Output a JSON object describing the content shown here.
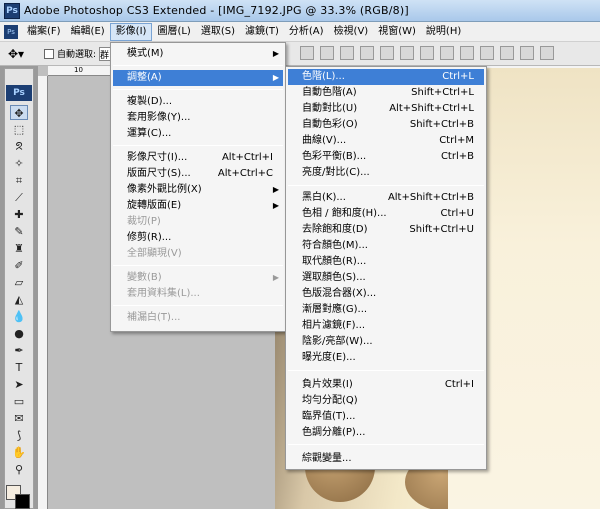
{
  "window": {
    "title": "Adobe Photoshop CS3 Extended - [IMG_7192.JPG @ 33.3% (RGB/8)]",
    "logo": "Ps"
  },
  "menubar": {
    "items": [
      "檔案(F)",
      "編輯(E)",
      "影像(I)",
      "圖層(L)",
      "選取(S)",
      "濾鏡(T)",
      "分析(A)",
      "檢視(V)",
      "視窗(W)",
      "說明(H)"
    ],
    "active_index": 2
  },
  "options": {
    "auto_select_label": "自動選取:",
    "auto_select_value": "群"
  },
  "tools": {
    "logo": "Ps"
  },
  "ruler": {
    "mark_1": "10",
    "mark_2": "30"
  },
  "image_menu": {
    "items": [
      {
        "label": "模式(M)",
        "submenu": true
      },
      {
        "label": "調整(A)",
        "submenu": true,
        "highlighted": true
      },
      {
        "label": "複製(D)..."
      },
      {
        "label": "套用影像(Y)..."
      },
      {
        "label": "運算(C)..."
      },
      {
        "label": "影像尺寸(I)...",
        "shortcut": "Alt+Ctrl+I"
      },
      {
        "label": "版面尺寸(S)...",
        "shortcut": "Alt+Ctrl+C"
      },
      {
        "label": "像素外觀比例(X)",
        "submenu": true
      },
      {
        "label": "旋轉版面(E)",
        "submenu": true
      },
      {
        "label": "裁切(P)",
        "disabled": true
      },
      {
        "label": "修剪(R)..."
      },
      {
        "label": "全部顯現(V)",
        "disabled": true
      },
      {
        "label": "變數(B)",
        "submenu": true,
        "disabled": true
      },
      {
        "label": "套用資料集(L)...",
        "disabled": true
      },
      {
        "label": "補漏白(T)...",
        "disabled": true
      }
    ]
  },
  "adjust_menu": {
    "items": [
      {
        "label": "色階(L)...",
        "shortcut": "Ctrl+L",
        "highlighted": true
      },
      {
        "label": "自動色階(A)",
        "shortcut": "Shift+Ctrl+L"
      },
      {
        "label": "自動對比(U)",
        "shortcut": "Alt+Shift+Ctrl+L"
      },
      {
        "label": "自動色彩(O)",
        "shortcut": "Shift+Ctrl+B"
      },
      {
        "label": "曲線(V)...",
        "shortcut": "Ctrl+M"
      },
      {
        "label": "色彩平衡(B)...",
        "shortcut": "Ctrl+B"
      },
      {
        "label": "亮度/對比(C)..."
      },
      {
        "label": "黑白(K)...",
        "shortcut": "Alt+Shift+Ctrl+B"
      },
      {
        "label": "色相 / 飽和度(H)...",
        "shortcut": "Ctrl+U"
      },
      {
        "label": "去除飽和度(D)",
        "shortcut": "Shift+Ctrl+U"
      },
      {
        "label": "符合顏色(M)..."
      },
      {
        "label": "取代顏色(R)..."
      },
      {
        "label": "選取顏色(S)..."
      },
      {
        "label": "色版混合器(X)..."
      },
      {
        "label": "漸層對應(G)..."
      },
      {
        "label": "相片濾鏡(F)..."
      },
      {
        "label": "陰影/亮部(W)..."
      },
      {
        "label": "曝光度(E)..."
      },
      {
        "label": "負片效果(I)",
        "shortcut": "Ctrl+I"
      },
      {
        "label": "均勻分配(Q)"
      },
      {
        "label": "臨界值(T)..."
      },
      {
        "label": "色調分離(P)..."
      },
      {
        "label": "綜觀變量..."
      }
    ]
  }
}
